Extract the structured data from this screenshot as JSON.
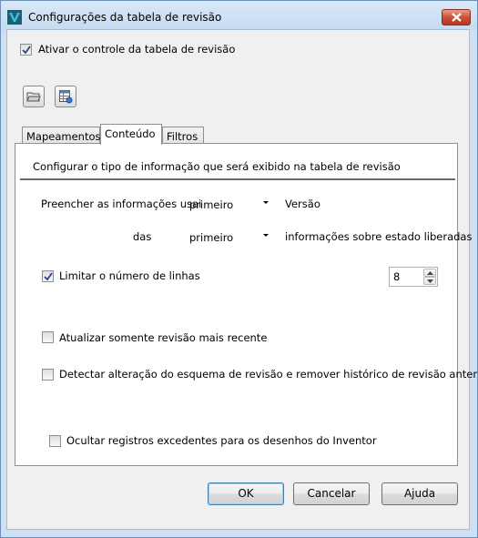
{
  "window": {
    "title": "Configurações da tabela de revisão"
  },
  "enable_control": {
    "label": "Ativar o controle da tabela de revisão",
    "checked": true
  },
  "toolbar": {
    "buttons": [
      "open-folder-icon",
      "table-settings-icon"
    ]
  },
  "tabs": [
    {
      "label": "Mapeamentos",
      "active": false
    },
    {
      "label": "Conteúdo",
      "active": true
    },
    {
      "label": "Filtros",
      "active": false
    }
  ],
  "content": {
    "header": "Configurar o tipo de informação que será exibido na tabela de revisão",
    "fill_label": "Preencher as informações usai",
    "fill_select": "primeiro",
    "fill_suffix": "Versão",
    "from_label": "das",
    "from_select": "primeiro",
    "from_suffix": "informações sobre estado liberadas",
    "limit_rows": {
      "label": "Limitar o número de linhas",
      "checked": true,
      "value": "8"
    },
    "update_latest": {
      "label": "Atualizar somente revisão mais recente",
      "checked": false
    },
    "detect_change": {
      "label": "Detectar alteração do esquema de revisão e remover histórico de revisão anterior",
      "checked": false
    },
    "hide_records": {
      "label": "Ocultar registros excedentes para os desenhos do Inventor",
      "checked": false
    }
  },
  "buttons": {
    "ok": "OK",
    "cancel": "Cancelar",
    "help": "Ajuda"
  },
  "colors": {
    "title_bar": "#cfe0f3",
    "close_button": "#c9503a",
    "check_mark": "#2a3f8f"
  }
}
